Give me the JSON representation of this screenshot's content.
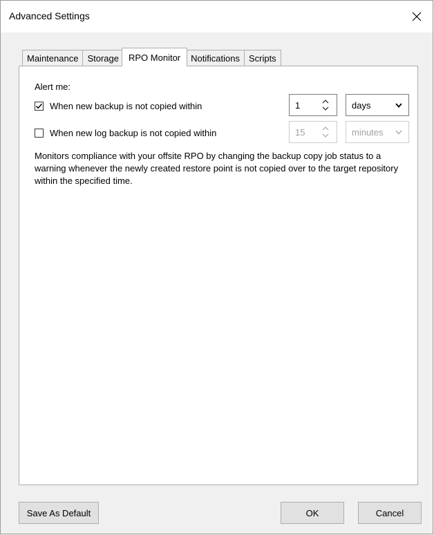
{
  "dialog": {
    "title": "Advanced Settings"
  },
  "tabs": [
    {
      "label": "Maintenance"
    },
    {
      "label": "Storage"
    },
    {
      "label": "RPO Monitor"
    },
    {
      "label": "Notifications"
    },
    {
      "label": "Scripts"
    }
  ],
  "rpo": {
    "alert_label": "Alert me:",
    "backup_row": {
      "label": "When new backup is not copied within",
      "checked": true,
      "value": "1",
      "unit": "days"
    },
    "log_row": {
      "label": "When new log backup is not copied within",
      "checked": false,
      "value": "15",
      "unit": "minutes"
    },
    "description": "Monitors compliance with your offsite RPO by changing the backup copy job status to a warning whenever the newly created restore point is not copied over to the target repository within the specified time."
  },
  "buttons": {
    "save_default": "Save As Default",
    "ok": "OK",
    "cancel": "Cancel"
  }
}
